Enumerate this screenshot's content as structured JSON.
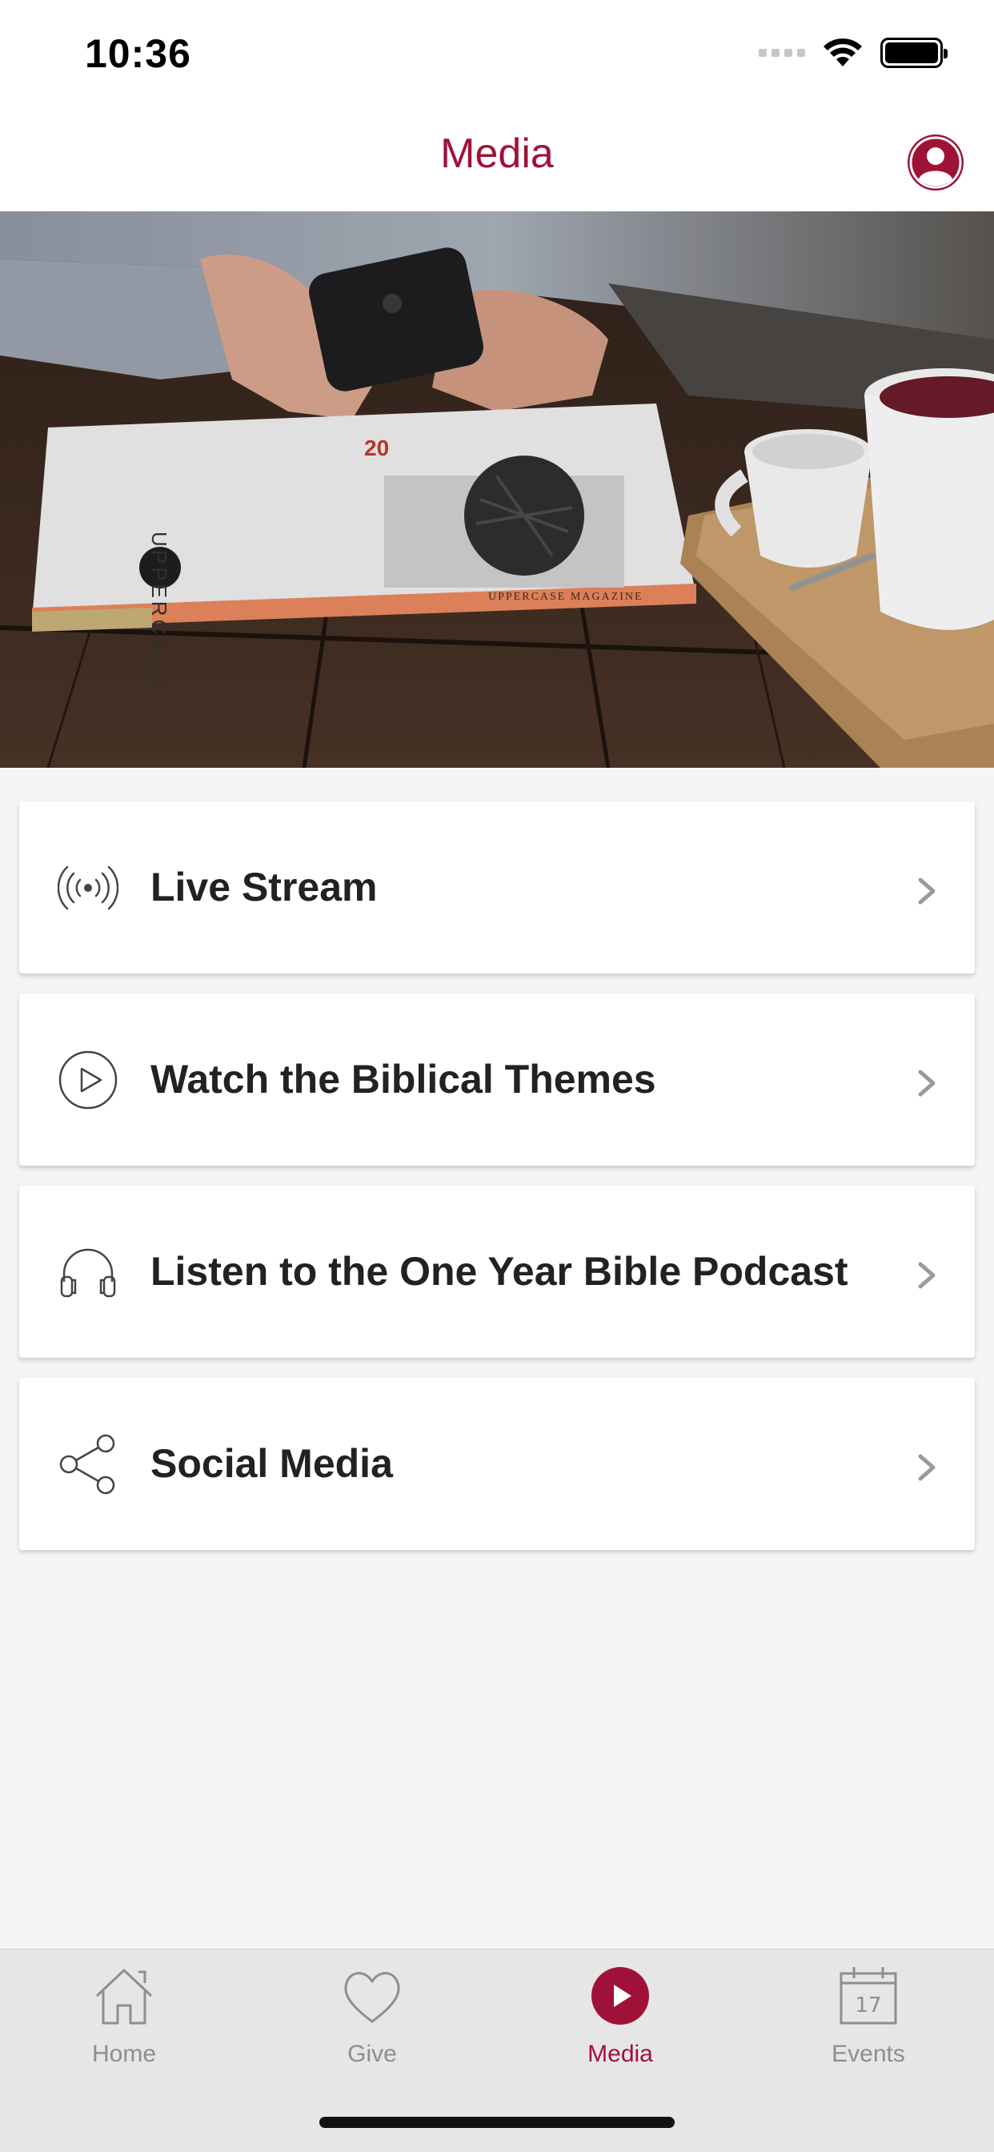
{
  "status_bar": {
    "time": "10:36"
  },
  "nav": {
    "title": "Media"
  },
  "menu": {
    "items": [
      {
        "label": "Live Stream",
        "icon": "broadcast-icon"
      },
      {
        "label": "Watch the Biblical Themes",
        "icon": "play-circle-icon"
      },
      {
        "label": "Listen to the One Year Bible Podcast",
        "icon": "headphones-icon"
      },
      {
        "label": "Social Media",
        "icon": "share-icon"
      }
    ]
  },
  "tabs": [
    {
      "label": "Home",
      "icon": "home-icon",
      "active": false
    },
    {
      "label": "Give",
      "icon": "heart-icon",
      "active": false
    },
    {
      "label": "Media",
      "icon": "play-circle-filled-icon",
      "active": true
    },
    {
      "label": "Events",
      "icon": "calendar-icon",
      "active": false
    }
  ],
  "hero_texts": {
    "book_title": "UPPERCASE",
    "book_spine": "UPPERCASE MAGAZINE",
    "issue": "20"
  },
  "colors": {
    "accent": "#a0113a",
    "tab_inactive": "#8e8e8e",
    "background": "#f5f5f5"
  }
}
